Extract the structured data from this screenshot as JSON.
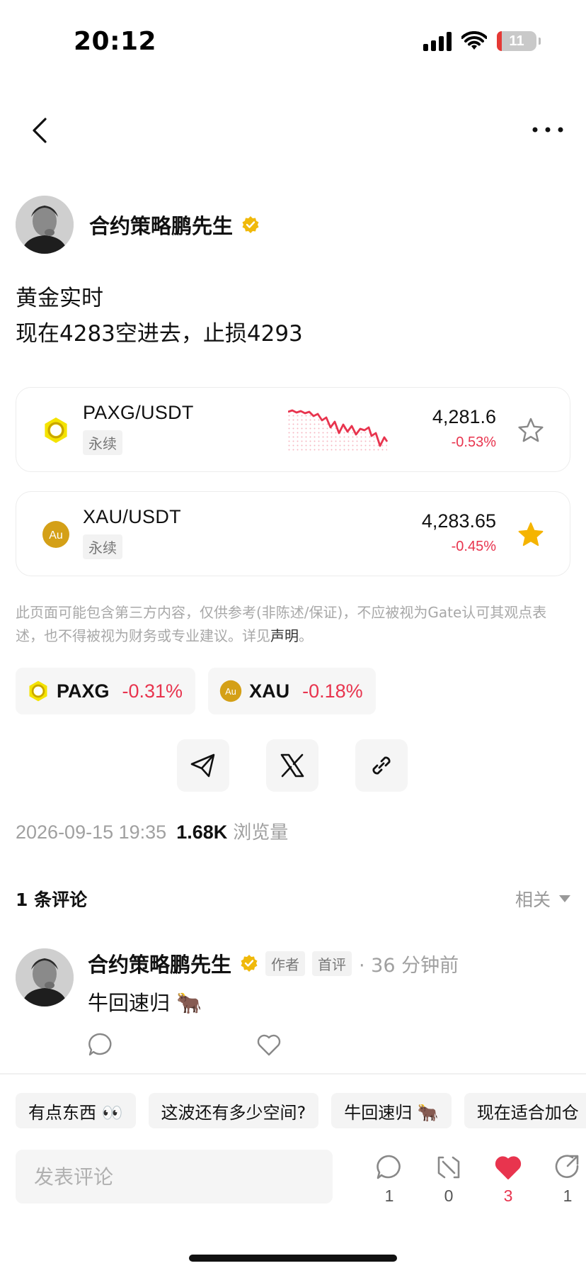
{
  "status_bar": {
    "time": "20:12",
    "battery": "11"
  },
  "nav": {
    "back_icon": "chevron-left-icon",
    "more_icon": "ellipsis-icon"
  },
  "post": {
    "author": "合约策略鹏先生",
    "lines": [
      "黄金实时",
      "现在4283空进去，止损4293"
    ]
  },
  "markets": [
    {
      "pair": "PAXG/USDT",
      "tag": "永续",
      "price": "4,281.6",
      "change": "-0.53%",
      "favorited": false,
      "icon": "paxg-coin-icon"
    },
    {
      "pair": "XAU/USDT",
      "tag": "永续",
      "price": "4,283.65",
      "change": "-0.45%",
      "favorited": true,
      "icon": "xau-coin-icon",
      "icon_text": "Au"
    }
  ],
  "disclaimer": {
    "text": "此页面可能包含第三方内容，仅供参考(非陈述/保证)，不应被视为Gate认可其观点表述，也不得被视为财务或专业建议。详见",
    "link": "声明",
    "end": "。"
  },
  "chips": [
    {
      "symbol": "PAXG",
      "change": "-0.31%"
    },
    {
      "symbol": "XAU",
      "change": "-0.18%",
      "icon_text": "Au"
    }
  ],
  "share": [
    "telegram-icon",
    "x-icon",
    "link-icon"
  ],
  "meta": {
    "datetime": "2026-09-15 19:35",
    "views": "1.68K",
    "views_label": "浏览量"
  },
  "comments": {
    "count_label": "1 条评论",
    "sort_label": "相关",
    "items": [
      {
        "author": "合约策略鹏先生",
        "badge_author": "作者",
        "badge_first": "首评",
        "time": "· 36 分钟前",
        "text": "牛回速归 🐂"
      }
    ]
  },
  "quick_replies": [
    "有点东西 👀",
    "这波还有多少空间?",
    "牛回速归 🐂",
    "现在适合加仓"
  ],
  "composer": {
    "placeholder": "发表评论"
  },
  "actions": {
    "comments": "1",
    "reposts": "0",
    "likes": "3",
    "shares": "1"
  },
  "colors": {
    "down": "#e8344e",
    "gold": "#f5b400",
    "verified": "#f0b90b"
  }
}
